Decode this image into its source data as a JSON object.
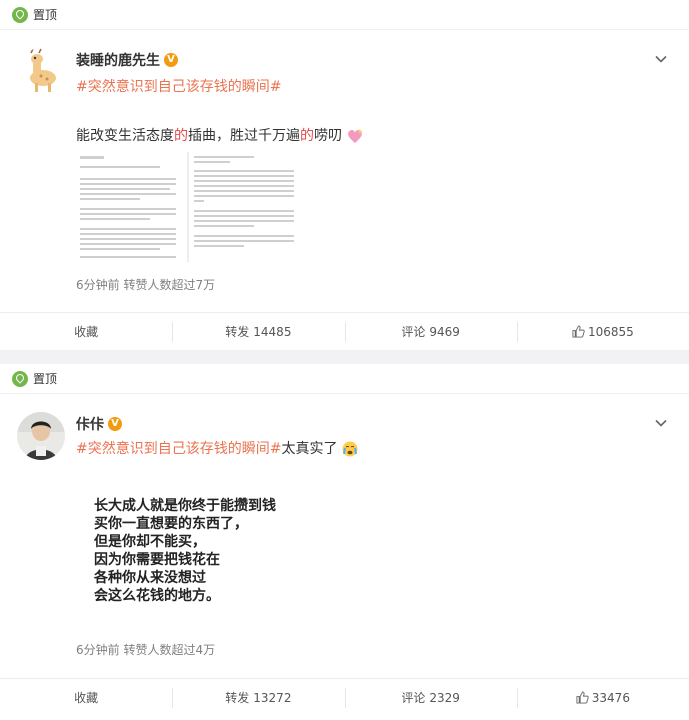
{
  "posts": [
    {
      "pin_label": "置顶",
      "username": "装睡的鹿先生",
      "verified": "V",
      "topic": "#突然意识到自己该存钱的瞬间#",
      "topic_suffix": "",
      "text_parts": [
        "能改变生活态度",
        "的",
        "插曲，胜过千万遍",
        "的",
        "唠叨"
      ],
      "emoji": "sparkling-heart",
      "image_text_left": "",
      "meta": "6分钟前 转赞人数超过7万",
      "actions": {
        "collect": "收藏",
        "repost": "转发",
        "repost_count": "14485",
        "comment": "评论",
        "comment_count": "9469",
        "like_count": "106855"
      }
    },
    {
      "pin_label": "置顶",
      "username": "佧佧",
      "verified": "V",
      "topic": "#突然意识到自己该存钱的瞬间#",
      "topic_suffix": "太真实了",
      "emoji": "crying-face",
      "image_lines": [
        "长大成人就是你终于能攒到钱",
        "买你一直想要的东西了，",
        "但是你却不能买，",
        "因为你需要把钱花在",
        "各种你从来没想过",
        "会这么花钱的地方。"
      ],
      "meta": "6分钟前 转赞人数超过4万",
      "actions": {
        "collect": "收藏",
        "repost": "转发",
        "repost_count": "13272",
        "comment": "评论",
        "comment_count": "2329",
        "like_count": "33476"
      }
    }
  ],
  "colors": {
    "topic": "#eb7350",
    "highlight": "#e64a4a",
    "pin": "#73b74a",
    "verified": "#f29b10"
  }
}
